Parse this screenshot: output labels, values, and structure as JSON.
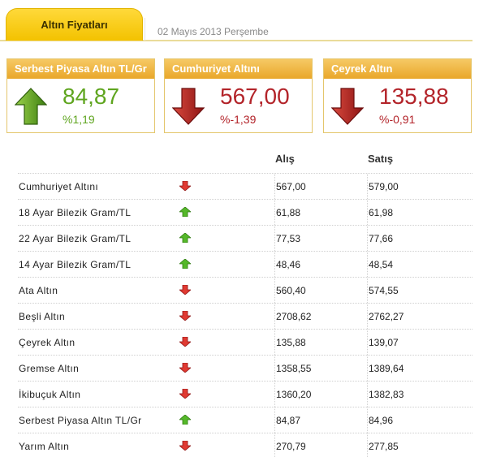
{
  "header": {
    "tab_label": "Altın Fiyatları",
    "date": "02 Mayıs 2013 Perşembe"
  },
  "cards": [
    {
      "title": "Serbest Piyasa Altın TL/Gr",
      "price": "84,87",
      "change": "%1,19",
      "direction": "up",
      "icon": "arrow-up-icon"
    },
    {
      "title": "Cumhuriyet Altını",
      "price": "567,00",
      "change": "%-1,39",
      "direction": "down",
      "icon": "arrow-down-icon"
    },
    {
      "title": "Çeyrek Altın",
      "price": "135,88",
      "change": "%-0,91",
      "direction": "down",
      "icon": "arrow-down-icon"
    }
  ],
  "table": {
    "columns": {
      "buy": "Alış",
      "sell": "Satış"
    },
    "rows": [
      {
        "name": "Cumhuriyet Altını",
        "direction": "down",
        "buy": "567,00",
        "sell": "579,00"
      },
      {
        "name": "18 Ayar Bilezik Gram/TL",
        "direction": "up",
        "buy": "61,88",
        "sell": "61,98"
      },
      {
        "name": "22 Ayar Bilezik Gram/TL",
        "direction": "up",
        "buy": "77,53",
        "sell": "77,66"
      },
      {
        "name": "14 Ayar Bilezik Gram/TL",
        "direction": "up",
        "buy": "48,46",
        "sell": "48,54"
      },
      {
        "name": "Ata Altın",
        "direction": "down",
        "buy": "560,40",
        "sell": "574,55"
      },
      {
        "name": "Beşli Altın",
        "direction": "down",
        "buy": "2708,62",
        "sell": "2762,27"
      },
      {
        "name": "Çeyrek Altın",
        "direction": "down",
        "buy": "135,88",
        "sell": "139,07"
      },
      {
        "name": "Gremse Altın",
        "direction": "down",
        "buy": "1358,55",
        "sell": "1389,64"
      },
      {
        "name": "İkibuçuk Altın",
        "direction": "down",
        "buy": "1360,20",
        "sell": "1382,83"
      },
      {
        "name": "Serbest Piyasa Altın TL/Gr",
        "direction": "up",
        "buy": "84,87",
        "sell": "84,96"
      },
      {
        "name": "Yarım Altın",
        "direction": "down",
        "buy": "270,79",
        "sell": "277,85"
      }
    ]
  },
  "colors": {
    "up": "#5fa51f",
    "down": "#b3242a",
    "accent": "#f3c200"
  }
}
